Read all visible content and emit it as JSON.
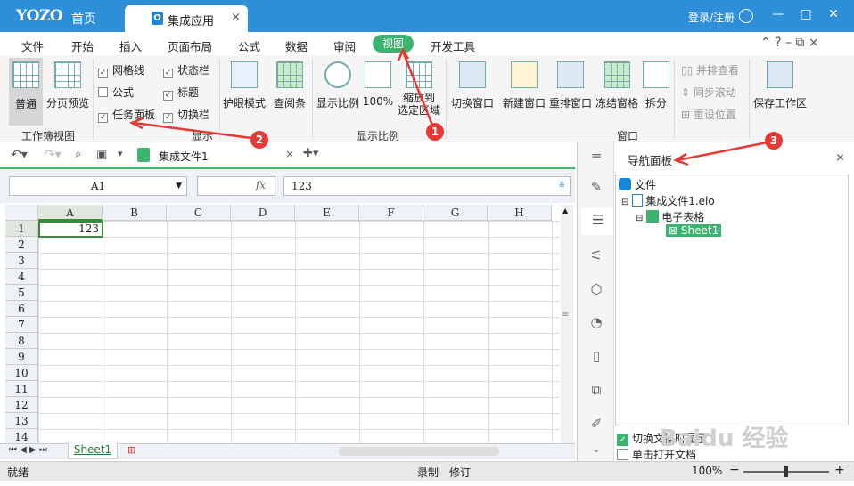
{
  "titlebar": {
    "logo": "YOZO",
    "home": "首页",
    "tab": "集成应用",
    "tab_icon": "O",
    "close": "×",
    "login": "登录/注册",
    "min": "—",
    "max": "□",
    "close_win": "✕"
  },
  "menu": {
    "items": [
      "文件",
      "开始",
      "插入",
      "页面布局",
      "公式",
      "数据",
      "审阅",
      "视图",
      "开发工具"
    ],
    "right": "⌃ ? – ⧉ ×"
  },
  "ribbon": {
    "normal": "普通",
    "pagepreview": "分页预览",
    "group_workbook": "工作簿视图",
    "checks": [
      {
        "label": "网格线",
        "checked": true
      },
      {
        "label": "公式",
        "checked": false
      },
      {
        "label": "任务面板",
        "checked": true
      },
      {
        "label": "状态栏",
        "checked": true
      },
      {
        "label": "标题",
        "checked": true
      },
      {
        "label": "切换栏",
        "checked": true
      }
    ],
    "group_show": "显示",
    "eye": "护眼模式",
    "readbar": "查阅条",
    "zoom": "显示比例",
    "zoom100": "100%",
    "zoomsel1": "缩放到",
    "zoomsel2": "选定区域",
    "group_zoom": "显示比例",
    "switchwin": "切换窗口",
    "newwin": "新建窗口",
    "arrange": "重排窗口",
    "freeze": "冻结窗格",
    "split": "拆分",
    "sidebyside": "并排查看",
    "syncscroll": "同步滚动",
    "resetpos": "重设位置",
    "group_window": "窗口",
    "savews": "保存工作区"
  },
  "doctab": {
    "name": "集成文件1",
    "close": "×"
  },
  "formula": {
    "cellref": "A1",
    "fx": "fx",
    "value": "123"
  },
  "sheet": {
    "columns": [
      "A",
      "B",
      "C",
      "D",
      "E",
      "F",
      "G",
      "H"
    ],
    "rows": [
      "1",
      "2",
      "3",
      "4",
      "5",
      "6",
      "7",
      "8",
      "9",
      "10",
      "11",
      "12",
      "13",
      "14"
    ],
    "a1": "123",
    "tab": "Sheet1"
  },
  "status": {
    "ready": "就绪",
    "record": "录制",
    "revise": "修订",
    "zoom": "100%",
    "minus": "−",
    "plus": "+"
  },
  "nav": {
    "title": "导航面板",
    "close": "×",
    "root": "文件",
    "file": "集成文件1.eio",
    "ss": "电子表格",
    "sheet": "Sheet1",
    "opt1": "切换文档时显示",
    "opt2": "单击打开文档"
  },
  "annotations": [
    "1",
    "2",
    "3"
  ],
  "watermark": "Baidu 经验"
}
